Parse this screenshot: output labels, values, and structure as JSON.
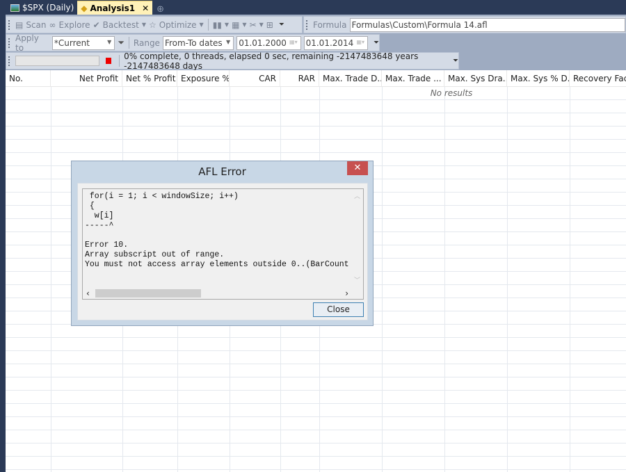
{
  "tabs": [
    {
      "label": "$SPX (Daily)",
      "icon": "chart-icon"
    },
    {
      "label": "Analysis1",
      "icon": "analysis-icon",
      "close": "✕"
    }
  ],
  "toolbar": {
    "scan": "Scan",
    "explore": "Explore",
    "backtest": "Backtest",
    "optimize": "Optimize",
    "formula_label": "Formula",
    "formula_value": "Formulas\\Custom\\Formula 14.afl",
    "apply_to_label": "Apply to",
    "apply_to_value": "*Current",
    "range_label": "Range",
    "range_value": "From-To dates",
    "from_date": "01.01.2000",
    "to_date": "01.01.2014",
    "status": "0% complete, 0 threads, elapsed 0 sec, remaining -2147483648 years -2147483648 days",
    "progress": 0,
    "stop_color": "#ee0000"
  },
  "columns": [
    "No.",
    "Net Profit",
    "Net % Profit",
    "Exposure %",
    "CAR",
    "RAR",
    "Max. Trade D...",
    "Max. Trade ...",
    "Max. Sys Dra...",
    "Max. Sys % D...",
    "Recovery Fac..."
  ],
  "no_results": "No results",
  "dialog": {
    "title": "AFL Error",
    "close_x": "✕",
    "message": " for(i = 1; i < windowSize; i++)\n {\n  w[i]\n-----^\n\nError 10.\nArray subscript out of range.\nYou must not access array elements outside 0..(BarCount",
    "close_button": "Close"
  }
}
